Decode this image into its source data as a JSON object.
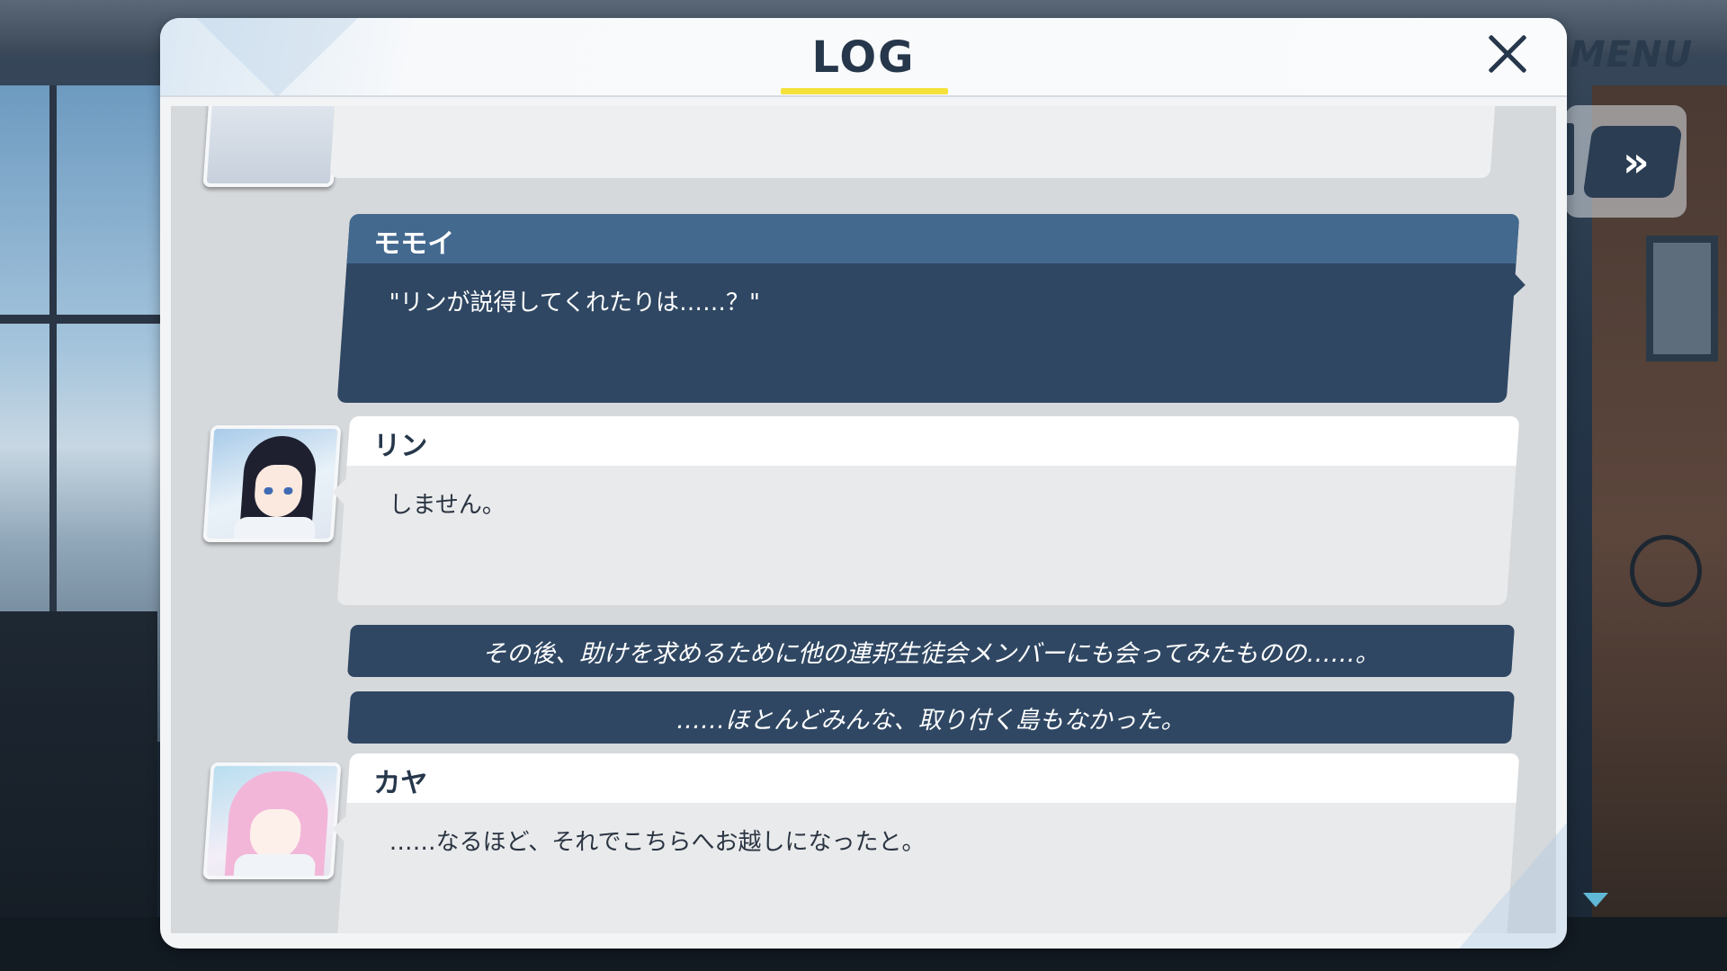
{
  "header": {
    "title": "LOG",
    "menu_label": "MENU",
    "fast_forward_label": "»"
  },
  "log": {
    "entries": [
      {
        "type": "dialogue",
        "speaker": "モモイ",
        "text": "\"リンが説得してくれたりは……？\"",
        "style": "dark"
      },
      {
        "type": "dialogue",
        "speaker": "リン",
        "text": "しません。",
        "style": "light"
      },
      {
        "type": "narration",
        "text": "その後、助けを求めるために他の連邦生徒会メンバーにも会ってみたものの……。"
      },
      {
        "type": "narration",
        "text": "……ほとんどみんな、取り付く島もなかった。"
      },
      {
        "type": "dialogue",
        "speaker": "カヤ",
        "text": "……なるほど、それでこちらへお越しになったと。",
        "style": "light"
      }
    ]
  },
  "colors": {
    "panel_bg": "#f2f4f6",
    "log_bg": "#d6d9dc",
    "dark_bubble": "#2f4763",
    "dark_header": "#44698f",
    "title_underline": "#f4e13a",
    "title_text": "#26374b",
    "scroll_indicator": "#5fb8d6"
  },
  "icons": {
    "close": "close-icon",
    "fast_forward": "fast-forward-icon",
    "scroll_down": "scroll-down-icon"
  }
}
